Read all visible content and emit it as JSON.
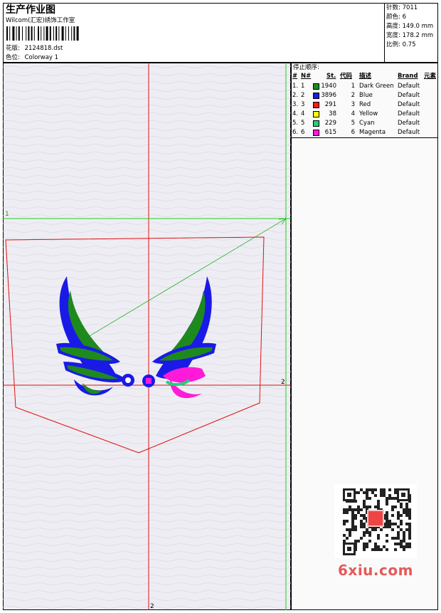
{
  "header": {
    "title": "生产作业图",
    "company": "Wilcom(汇宏)绣饰工作室",
    "design_label": "花版:",
    "design_value": "2124818.dst",
    "colorway_label": "色位:",
    "colorway_value": "Colorway 1"
  },
  "stats": [
    {
      "label": "针数:",
      "value": "7011"
    },
    {
      "label": "颜色:",
      "value": "6"
    },
    {
      "label": "高度:",
      "value": "149.0 mm"
    },
    {
      "label": "宽度:",
      "value": "178.2 mm"
    },
    {
      "label": "比例:",
      "value": "0.75"
    }
  ],
  "stop_sequence": {
    "title": "停止顺序:",
    "columns": [
      "#",
      "N#",
      "St.",
      "代码",
      "描述",
      "Brand",
      "元素"
    ],
    "rows": [
      {
        "idx": "1.",
        "n": "1",
        "stitches": "1940",
        "code": "1",
        "desc": "Dark Green",
        "brand": "Default",
        "color": "#1e8a1e"
      },
      {
        "idx": "2.",
        "n": "2",
        "stitches": "3896",
        "code": "2",
        "desc": "Blue",
        "brand": "Default",
        "color": "#1a1ae6"
      },
      {
        "idx": "3.",
        "n": "3",
        "stitches": "291",
        "code": "3",
        "desc": "Red",
        "brand": "Default",
        "color": "#ff1a1a"
      },
      {
        "idx": "4.",
        "n": "4",
        "stitches": "38",
        "code": "4",
        "desc": "Yellow",
        "brand": "Default",
        "color": "#ffff00"
      },
      {
        "idx": "5.",
        "n": "5",
        "stitches": "229",
        "code": "5",
        "desc": "Cyan",
        "brand": "Default",
        "color": "#20d27a"
      },
      {
        "idx": "6.",
        "n": "6",
        "stitches": "615",
        "code": "6",
        "desc": "Magenta",
        "brand": "Default",
        "color": "#ff1ad9"
      }
    ]
  },
  "canvas": {
    "marker_1_left": "1",
    "marker_2_right": "2",
    "marker_2_bottom": "2",
    "colors": {
      "guide_red": "#e01010",
      "guide_green": "#20d020",
      "background": "#eeedf3"
    }
  },
  "watermark": {
    "site": "6xiu.com"
  }
}
